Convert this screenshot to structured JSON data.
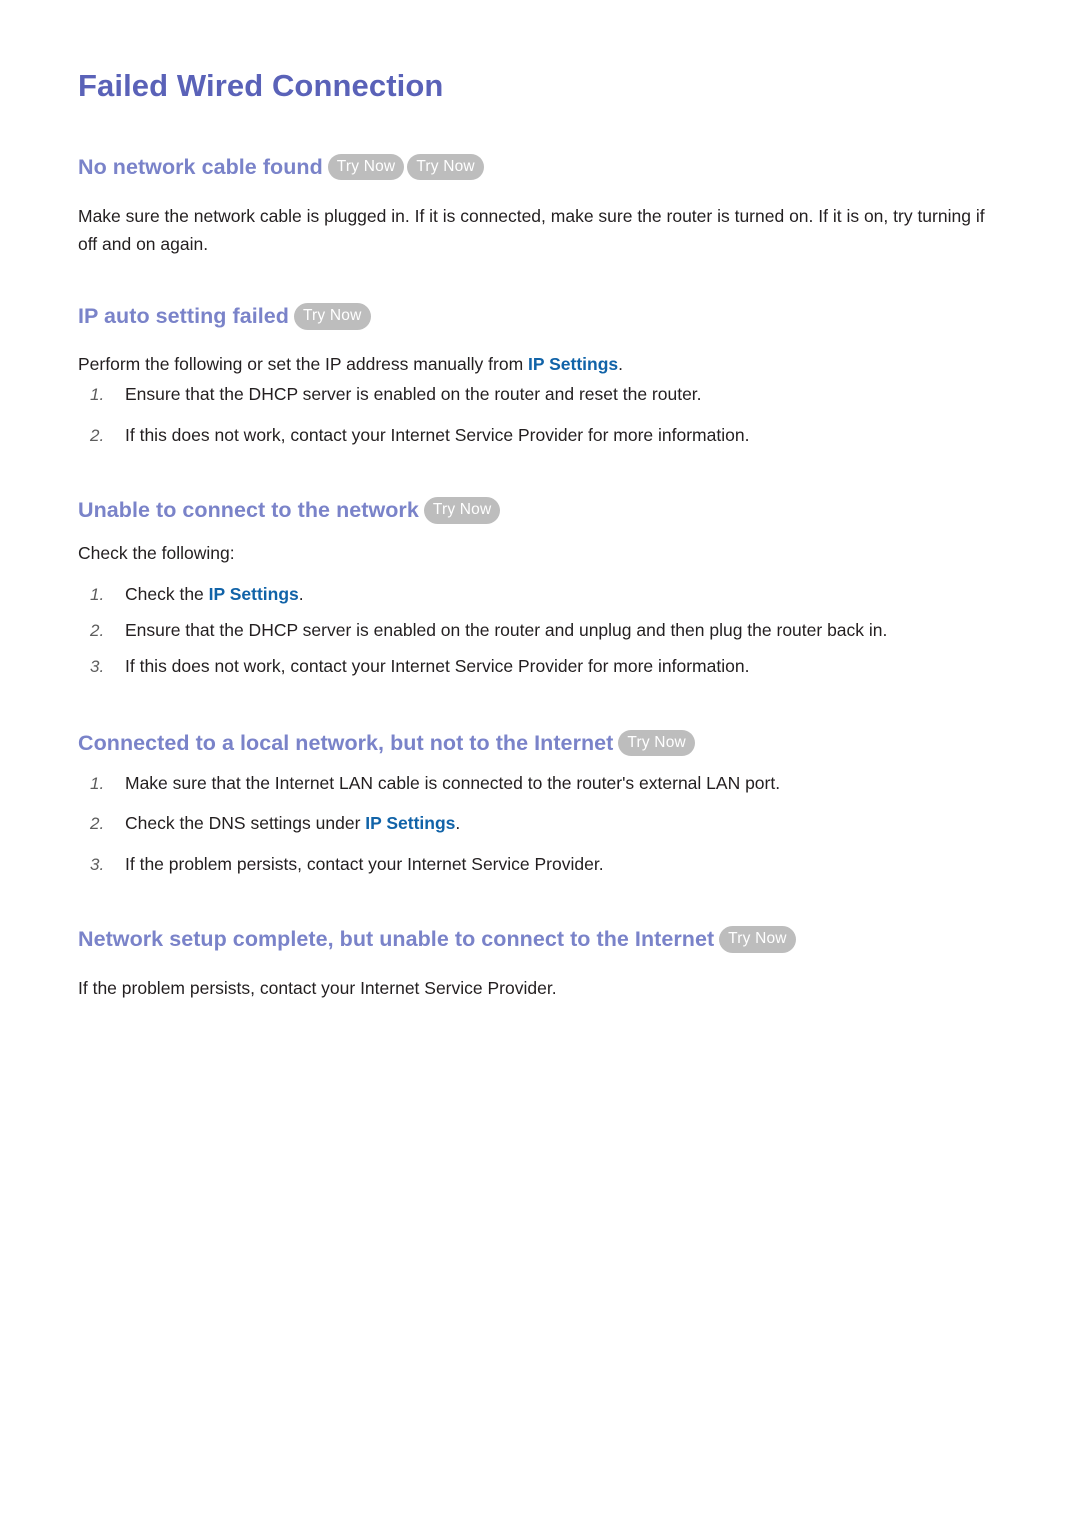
{
  "page": {
    "title": "Failed Wired Connection",
    "accent_title_color": "#5a62b8",
    "accent_heading_color": "#7a83c9",
    "link_color": "#1163a8",
    "badge_bg_color": "#bdbdbd",
    "badge_text_color": "#ffffff",
    "body_color": "#231f20"
  },
  "badges": {
    "try_now": "Try Now"
  },
  "sections": {
    "no_cable": {
      "heading": "No network cable found",
      "badge_count": 2,
      "paragraph": "Make sure the network cable is plugged in. If it is connected, make sure the router is turned on. If it is on, try turning if off and on again."
    },
    "ip_auto_failed": {
      "heading": "IP auto setting failed",
      "intro_before_link": "Perform the following or set the IP address manually from ",
      "intro_link": "IP Settings",
      "intro_after_link": ".",
      "steps": [
        "Ensure that the DHCP server is enabled on the router and reset the router.",
        "If this does not work, contact your Internet Service Provider for more information."
      ]
    },
    "unable_connect": {
      "heading": "Unable to connect to the network",
      "intro": "Check the following:",
      "step1_before_link": "Check the ",
      "step1_link": "IP Settings",
      "step1_after_link": ".",
      "step2": "Ensure that the DHCP server is enabled on the router and unplug and then plug the router back in.",
      "step3": "If this does not work, contact your Internet Service Provider for more information."
    },
    "local_no_internet": {
      "heading": "Connected to a local network, but not to the Internet",
      "step1": "Make sure that the Internet LAN cable is connected to the router's external LAN port.",
      "step2_before_link": "Check the DNS settings under ",
      "step2_link": "IP Settings",
      "step2_after_link": ".",
      "step3": "If the problem persists, contact your Internet Service Provider."
    },
    "setup_complete_no_internet": {
      "heading": "Network setup complete, but unable to connect to the Internet",
      "paragraph": "If the problem persists, contact your Internet Service Provider."
    }
  }
}
